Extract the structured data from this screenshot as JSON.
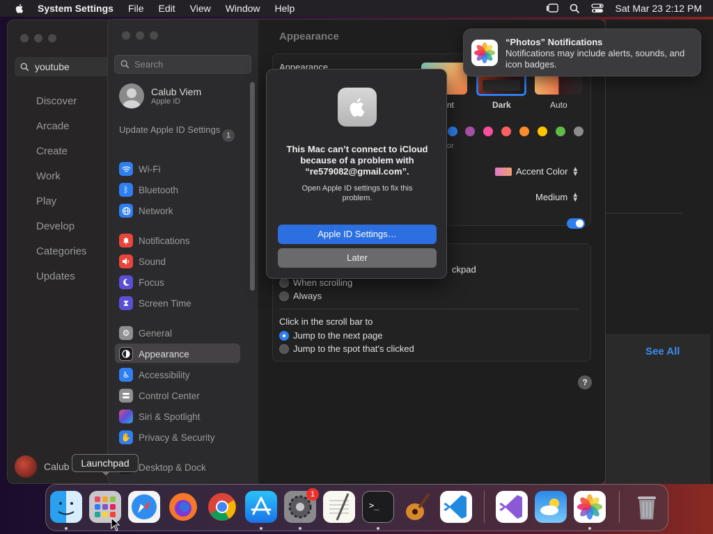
{
  "menubar": {
    "app_name": "System Settings",
    "items": [
      "File",
      "Edit",
      "View",
      "Window",
      "Help"
    ],
    "datetime": "Sat Mar 23  2:12 PM"
  },
  "appstore": {
    "search_value": "youtube",
    "nav": [
      "Discover",
      "Arcade",
      "Create",
      "Work",
      "Play",
      "Develop",
      "Categories",
      "Updates"
    ],
    "user_name": "Calub",
    "see_all": "See All"
  },
  "settings": {
    "search_placeholder": "Search",
    "profile": {
      "name": "Calub Viem",
      "subtitle": "Apple ID"
    },
    "update_label": "Update Apple ID Settings",
    "update_badge": "1",
    "sidebar": [
      {
        "label": "Wi-Fi",
        "icon": "wifi-icon",
        "color": "#2f7ff0"
      },
      {
        "label": "Bluetooth",
        "icon": "bluetooth-icon",
        "color": "#2f7ff0"
      },
      {
        "label": "Network",
        "icon": "globe-icon",
        "color": "#2f7ff0"
      },
      {
        "label": "Notifications",
        "icon": "bell-icon",
        "color": "#e8453c"
      },
      {
        "label": "Sound",
        "icon": "speaker-icon",
        "color": "#e8453c"
      },
      {
        "label": "Focus",
        "icon": "moon-icon",
        "color": "#5b4fd6"
      },
      {
        "label": "Screen Time",
        "icon": "hourglass-icon",
        "color": "#5b4fd6"
      },
      {
        "label": "General",
        "icon": "gear-icon",
        "color": "#8e8e93"
      },
      {
        "label": "Appearance",
        "icon": "appearance-icon",
        "color": "#1c1c1e"
      },
      {
        "label": "Accessibility",
        "icon": "accessibility-icon",
        "color": "#2f7ff0"
      },
      {
        "label": "Control Center",
        "icon": "control-center-icon",
        "color": "#8e8e93"
      },
      {
        "label": "Siri & Spotlight",
        "icon": "siri-icon",
        "color": "#b04ad6"
      },
      {
        "label": "Privacy & Security",
        "icon": "hand-icon",
        "color": "#2f7ff0"
      },
      {
        "label": "Desktop & Dock",
        "icon": "dock-icon",
        "color": "#1c1c1e"
      }
    ],
    "main": {
      "header": "Appearance",
      "appearance_label": "Appearance",
      "options": [
        "nt",
        "Dark",
        "Auto"
      ],
      "accent_fragment": "or",
      "accent_colors": [
        "#2f7ff0",
        "#a550a7",
        "#f74f9e",
        "#fc5f5f",
        "#fd8c2a",
        "#ffc600",
        "#62ba46",
        "#8c8c8c"
      ],
      "highlight_label": "Accent Color",
      "sidebar_icon_size": "Medium",
      "scroll_heading_fragment": "ckpad",
      "scroll_opts": [
        "When scrolling",
        "Always"
      ],
      "click_heading": "Click in the scroll bar to",
      "click_opts": [
        "Jump to the next page",
        "Jump to the spot that's clicked"
      ]
    }
  },
  "dialog": {
    "title": "This Mac can’t connect to iCloud because of a problem with “re579082@gmail.com”.",
    "message": "Open Apple ID settings to fix this problem.",
    "primary": "Apple ID Settings…",
    "secondary": "Later"
  },
  "notification": {
    "title": "“Photos” Notifications",
    "body": "Notifications may include alerts, sounds, and icon badges."
  },
  "dock": {
    "tooltip": "Launchpad",
    "settings_badge": "1"
  }
}
